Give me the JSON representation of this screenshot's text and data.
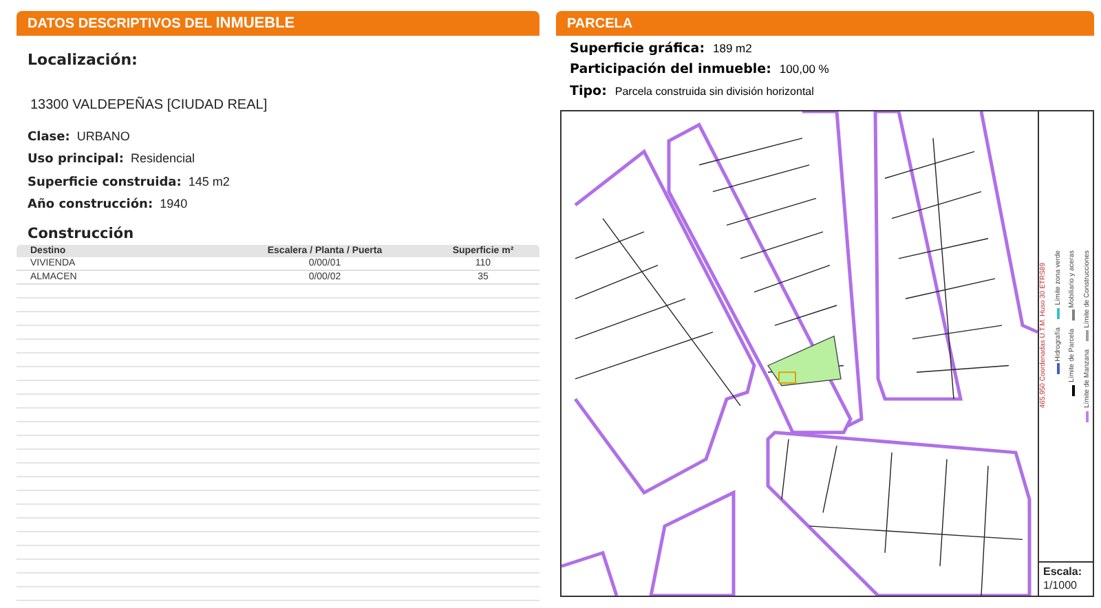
{
  "inmueble": {
    "title_parts": [
      "DATOS DESCRIPTIVOS DEL ",
      "INMUEBLE"
    ],
    "localizacion_label": "Localización:",
    "address": "13300 VALDEPEÑAS [CIUDAD REAL]",
    "fields": [
      {
        "label": "Clase:",
        "value": "URBANO"
      },
      {
        "label": "Uso principal:",
        "value": "Residencial"
      },
      {
        "label": "Superficie construida:",
        "value": "145 m2"
      },
      {
        "label": "Año construcción:",
        "value": "1940"
      }
    ],
    "construccion": {
      "title": "Construcción",
      "columns": [
        "Destino",
        "Escalera / Planta / Puerta",
        "Superficie m²"
      ],
      "rows": [
        [
          "VIVIENDA",
          "0/00/01",
          "110"
        ],
        [
          "ALMACEN",
          "0/00/02",
          "35"
        ]
      ]
    }
  },
  "parcela": {
    "title": "PARCELA",
    "fields": [
      {
        "label": "Superficie gráfica:",
        "value": "189 m2"
      },
      {
        "label": "Participación del inmueble:",
        "value": "100,00 %"
      },
      {
        "label": "Tipo:",
        "value": "Parcela construida sin división horizontal"
      }
    ],
    "legend": [
      {
        "label": "Límite de Manzana",
        "color": "#c080f0"
      },
      {
        "label": "Límite de Construcciones",
        "color": "#a0a0a0"
      },
      {
        "label": "Límite de Parcela",
        "color": "#000000"
      },
      {
        "label": "Mobiliario y aceras",
        "color": "#808080"
      },
      {
        "label": "Hidrografía",
        "color": "#4060c0"
      },
      {
        "label": "Límite zona verde",
        "color": "#40c0c0"
      }
    ],
    "coords_note": "465,950 Coordenadas U.T.M. Huso 30 ETRS89",
    "scale_label": "Escala:",
    "scale": "1/1000"
  }
}
